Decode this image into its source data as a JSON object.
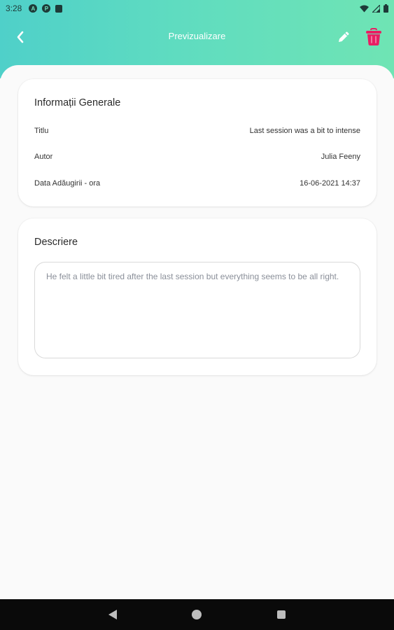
{
  "status_bar": {
    "time": "3:28",
    "icons": [
      "autofill-icon",
      "play-protect-icon",
      "sd-card-icon",
      "wifi-icon",
      "signal-icon",
      "battery-icon"
    ]
  },
  "app_bar": {
    "title": "Previzualizare",
    "back_icon": "chevron-left-icon",
    "edit_icon": "pencil-icon",
    "delete_icon": "trash-icon"
  },
  "general_info": {
    "title": "Informații Generale",
    "rows": [
      {
        "label": "Titlu",
        "value": "Last session was a bit to intense"
      },
      {
        "label": "Autor",
        "value": "Julia Feeny"
      },
      {
        "label": "Data Adăugirii - ora",
        "value": "16-06-2021 14:37"
      }
    ]
  },
  "description": {
    "title": "Descriere",
    "text": "He felt a little bit tired after the last session but everything seems to be all right."
  },
  "colors": {
    "header_gradient_start": "#4fd0c9",
    "header_gradient_end": "#6fe4b4",
    "delete_accent": "#e91e63",
    "background": "#fafafa"
  },
  "nav_bar": {
    "icons": [
      "nav-back-icon",
      "nav-home-icon",
      "nav-recents-icon"
    ]
  }
}
